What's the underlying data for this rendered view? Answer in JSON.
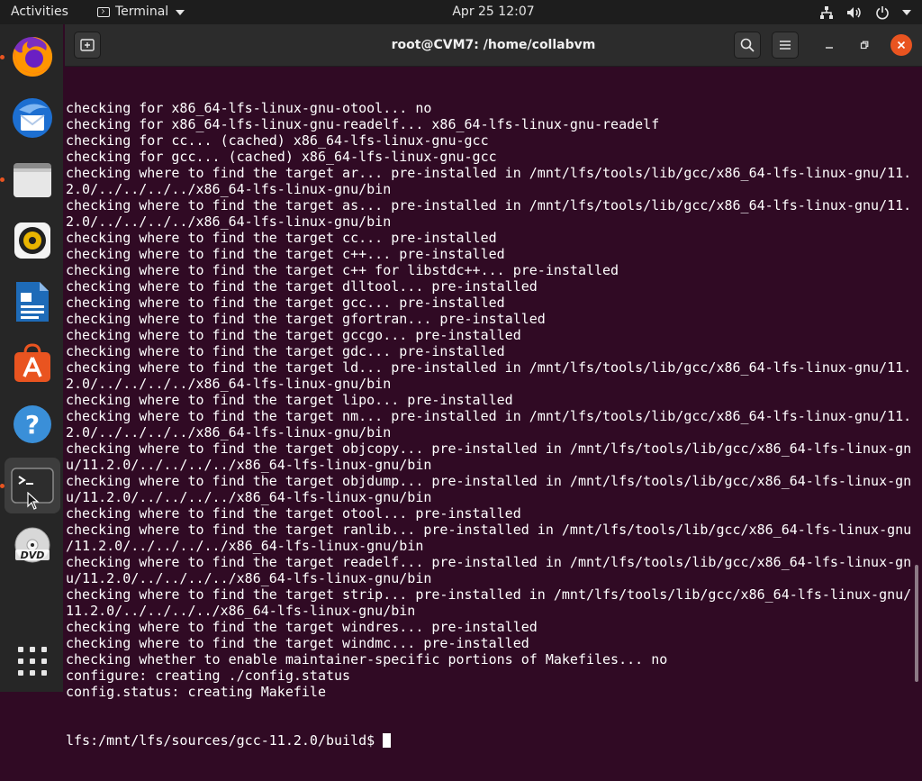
{
  "topbar": {
    "activities": "Activities",
    "app_name": "Terminal",
    "clock": "Apr 25  12:07"
  },
  "dock": {
    "items": [
      {
        "name": "firefox-icon",
        "running": true
      },
      {
        "name": "thunderbird-icon",
        "running": false
      },
      {
        "name": "files-icon",
        "running": true
      },
      {
        "name": "rhythmbox-icon",
        "running": false
      },
      {
        "name": "libreoffice-writer-icon",
        "running": false
      },
      {
        "name": "software-center-icon",
        "running": false
      },
      {
        "name": "help-icon",
        "running": false
      },
      {
        "name": "terminal-icon",
        "running": true
      },
      {
        "name": "dvd-icon",
        "running": false
      },
      {
        "name": "show-apps-icon",
        "running": false
      }
    ],
    "dvd_label": "DVD"
  },
  "window": {
    "title": "root@CVM7: /home/collabvm"
  },
  "terminal": {
    "lines": [
      "checking for x86_64-lfs-linux-gnu-otool... no",
      "checking for x86_64-lfs-linux-gnu-readelf... x86_64-lfs-linux-gnu-readelf",
      "checking for cc... (cached) x86_64-lfs-linux-gnu-gcc",
      "checking for gcc... (cached) x86_64-lfs-linux-gnu-gcc",
      "checking where to find the target ar... pre-installed in /mnt/lfs/tools/lib/gcc/x86_64-lfs-linux-gnu/11.",
      "2.0/../../../../x86_64-lfs-linux-gnu/bin",
      "checking where to find the target as... pre-installed in /mnt/lfs/tools/lib/gcc/x86_64-lfs-linux-gnu/11.",
      "2.0/../../../../x86_64-lfs-linux-gnu/bin",
      "checking where to find the target cc... pre-installed",
      "checking where to find the target c++... pre-installed",
      "checking where to find the target c++ for libstdc++... pre-installed",
      "checking where to find the target dlltool... pre-installed",
      "checking where to find the target gcc... pre-installed",
      "checking where to find the target gfortran... pre-installed",
      "checking where to find the target gccgo... pre-installed",
      "checking where to find the target gdc... pre-installed",
      "checking where to find the target ld... pre-installed in /mnt/lfs/tools/lib/gcc/x86_64-lfs-linux-gnu/11.",
      "2.0/../../../../x86_64-lfs-linux-gnu/bin",
      "checking where to find the target lipo... pre-installed",
      "checking where to find the target nm... pre-installed in /mnt/lfs/tools/lib/gcc/x86_64-lfs-linux-gnu/11.",
      "2.0/../../../../x86_64-lfs-linux-gnu/bin",
      "checking where to find the target objcopy... pre-installed in /mnt/lfs/tools/lib/gcc/x86_64-lfs-linux-gn",
      "u/11.2.0/../../../../x86_64-lfs-linux-gnu/bin",
      "checking where to find the target objdump... pre-installed in /mnt/lfs/tools/lib/gcc/x86_64-lfs-linux-gn",
      "u/11.2.0/../../../../x86_64-lfs-linux-gnu/bin",
      "checking where to find the target otool... pre-installed",
      "checking where to find the target ranlib... pre-installed in /mnt/lfs/tools/lib/gcc/x86_64-lfs-linux-gnu",
      "/11.2.0/../../../../x86_64-lfs-linux-gnu/bin",
      "checking where to find the target readelf... pre-installed in /mnt/lfs/tools/lib/gcc/x86_64-lfs-linux-gn",
      "u/11.2.0/../../../../x86_64-lfs-linux-gnu/bin",
      "checking where to find the target strip... pre-installed in /mnt/lfs/tools/lib/gcc/x86_64-lfs-linux-gnu/",
      "11.2.0/../../../../x86_64-lfs-linux-gnu/bin",
      "checking where to find the target windres... pre-installed",
      "checking where to find the target windmc... pre-installed",
      "checking whether to enable maintainer-specific portions of Makefiles... no",
      "configure: creating ./config.status",
      "config.status: creating Makefile"
    ],
    "prompt": "lfs:/mnt/lfs/sources/gcc-11.2.0/build$"
  },
  "colors": {
    "terminal_bg": "#300a24",
    "close_button": "#e95420",
    "running_indicator": "#e95420"
  }
}
